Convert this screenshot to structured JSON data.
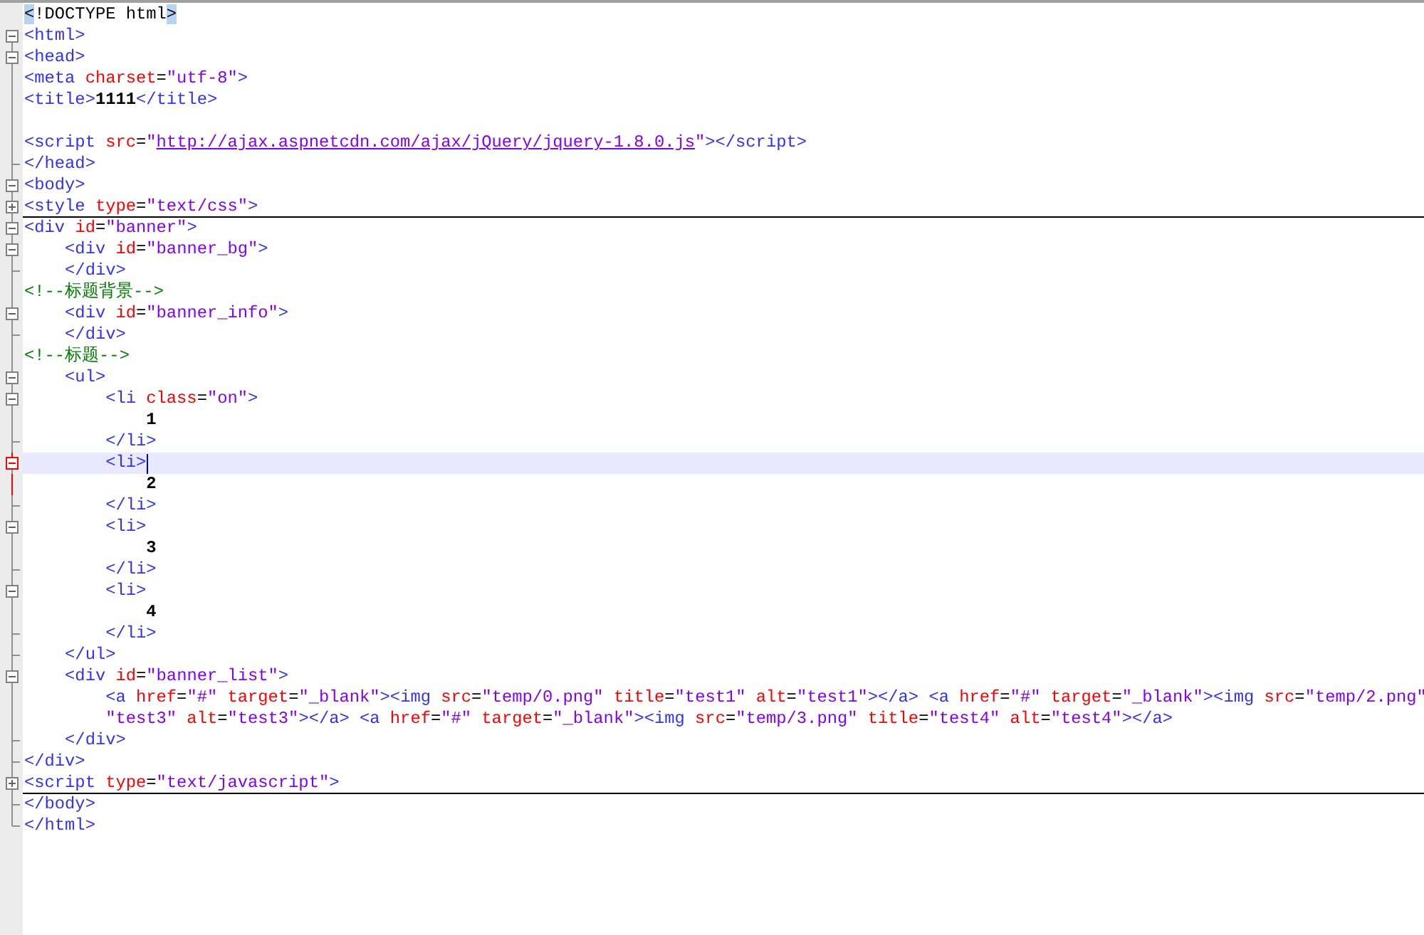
{
  "lines": [
    {
      "kind": "none",
      "tokens": [
        {
          "kind": "brace",
          "text": "<"
        },
        {
          "kind": "plain",
          "text": "!DOCTYPE html"
        },
        {
          "kind": "brace",
          "text": ">"
        }
      ]
    },
    {
      "kind": "root",
      "tokens": [
        {
          "kind": "tag",
          "text": "<html>"
        }
      ]
    },
    {
      "kind": "open",
      "tokens": [
        {
          "kind": "tag",
          "text": "<head>"
        }
      ]
    },
    {
      "kind": "line",
      "tokens": [
        {
          "kind": "tag",
          "text": "<meta "
        },
        {
          "kind": "attr",
          "text": "charset"
        },
        {
          "kind": "plain",
          "text": "="
        },
        {
          "kind": "value",
          "text": "\"utf-8\""
        },
        {
          "kind": "tag",
          "text": ">"
        }
      ]
    },
    {
      "kind": "line",
      "tokens": [
        {
          "kind": "tag",
          "text": "<title>"
        },
        {
          "kind": "text",
          "text": "1111"
        },
        {
          "kind": "tag",
          "text": "</title>"
        }
      ]
    },
    {
      "kind": "line"
    },
    {
      "kind": "line",
      "tokens": [
        {
          "kind": "tag",
          "text": "<script "
        },
        {
          "kind": "attr",
          "text": "src"
        },
        {
          "kind": "plain",
          "text": "="
        },
        {
          "kind": "value",
          "text": "\""
        },
        {
          "kind": "url",
          "text": "http://ajax.aspnetcdn.com/ajax/jQuery/jquery-1.8.0.js"
        },
        {
          "kind": "value",
          "text": "\""
        },
        {
          "kind": "tag",
          "text": "></script>"
        }
      ]
    },
    {
      "kind": "end",
      "tokens": [
        {
          "kind": "tag",
          "text": "</head>"
        }
      ]
    },
    {
      "kind": "open",
      "tokens": [
        {
          "kind": "tag",
          "text": "<body>"
        }
      ]
    },
    {
      "kind": "closed",
      "folded": true,
      "tokens": [
        {
          "kind": "tag",
          "text": "<style "
        },
        {
          "kind": "attr",
          "text": "type"
        },
        {
          "kind": "plain",
          "text": "="
        },
        {
          "kind": "value",
          "text": "\"text/css\""
        },
        {
          "kind": "tag",
          "text": ">"
        }
      ]
    },
    {
      "kind": "open",
      "tokens": [
        {
          "kind": "tag",
          "text": "<div "
        },
        {
          "kind": "attr",
          "text": "id"
        },
        {
          "kind": "plain",
          "text": "="
        },
        {
          "kind": "value",
          "text": "\"banner\""
        },
        {
          "kind": "tag",
          "text": ">"
        }
      ]
    },
    {
      "kind": "open",
      "tokens": [
        {
          "kind": "tag",
          "text": "    <div "
        },
        {
          "kind": "attr",
          "text": "id"
        },
        {
          "kind": "plain",
          "text": "="
        },
        {
          "kind": "value",
          "text": "\"banner_bg\""
        },
        {
          "kind": "tag",
          "text": ">"
        }
      ]
    },
    {
      "kind": "end",
      "tokens": [
        {
          "kind": "tag",
          "text": "    </div>"
        }
      ]
    },
    {
      "kind": "line",
      "tokens": [
        {
          "kind": "comment",
          "text": "<!--标题背景-->"
        }
      ]
    },
    {
      "kind": "open",
      "tokens": [
        {
          "kind": "tag",
          "text": "    <div "
        },
        {
          "kind": "attr",
          "text": "id"
        },
        {
          "kind": "plain",
          "text": "="
        },
        {
          "kind": "value",
          "text": "\"banner_info\""
        },
        {
          "kind": "tag",
          "text": ">"
        }
      ]
    },
    {
      "kind": "end",
      "tokens": [
        {
          "kind": "tag",
          "text": "    </div>"
        }
      ]
    },
    {
      "kind": "line",
      "tokens": [
        {
          "kind": "comment",
          "text": "<!--标题-->"
        }
      ]
    },
    {
      "kind": "open",
      "tokens": [
        {
          "kind": "tag",
          "text": "    <ul>"
        }
      ]
    },
    {
      "kind": "open",
      "tokens": [
        {
          "kind": "tag",
          "text": "        <li "
        },
        {
          "kind": "attr",
          "text": "class"
        },
        {
          "kind": "plain",
          "text": "="
        },
        {
          "kind": "value",
          "text": "\"on\""
        },
        {
          "kind": "tag",
          "text": ">"
        }
      ]
    },
    {
      "kind": "line",
      "tokens": [
        {
          "kind": "text",
          "text": "            1"
        }
      ]
    },
    {
      "kind": "end",
      "tokens": [
        {
          "kind": "tag",
          "text": "        </li>"
        }
      ]
    },
    {
      "kind": "open",
      "current": true,
      "fold_active": true,
      "caret": true,
      "tokens": [
        {
          "kind": "tag",
          "text": "        <li>"
        }
      ]
    },
    {
      "kind": "line",
      "fold_active": true,
      "tokens": [
        {
          "kind": "text",
          "text": "            2"
        }
      ]
    },
    {
      "kind": "end",
      "tokens": [
        {
          "kind": "tag",
          "text": "        </li>"
        }
      ]
    },
    {
      "kind": "open",
      "tokens": [
        {
          "kind": "tag",
          "text": "        <li>"
        }
      ]
    },
    {
      "kind": "line",
      "tokens": [
        {
          "kind": "text",
          "text": "            3"
        }
      ]
    },
    {
      "kind": "end",
      "tokens": [
        {
          "kind": "tag",
          "text": "        </li>"
        }
      ]
    },
    {
      "kind": "open",
      "tokens": [
        {
          "kind": "tag",
          "text": "        <li>"
        }
      ]
    },
    {
      "kind": "line",
      "tokens": [
        {
          "kind": "text",
          "text": "            4"
        }
      ]
    },
    {
      "kind": "end",
      "tokens": [
        {
          "kind": "tag",
          "text": "        </li>"
        }
      ]
    },
    {
      "kind": "end",
      "tokens": [
        {
          "kind": "tag",
          "text": "    </ul>"
        }
      ]
    },
    {
      "kind": "open",
      "tokens": [
        {
          "kind": "tag",
          "text": "    <div "
        },
        {
          "kind": "attr",
          "text": "id"
        },
        {
          "kind": "plain",
          "text": "="
        },
        {
          "kind": "value",
          "text": "\"banner_list\""
        },
        {
          "kind": "tag",
          "text": ">"
        }
      ]
    },
    {
      "kind": "line",
      "tokens": [
        {
          "kind": "tag",
          "text": "        <a "
        },
        {
          "kind": "attr",
          "text": "href"
        },
        {
          "kind": "plain",
          "text": "="
        },
        {
          "kind": "value",
          "text": "\"#\""
        },
        {
          "kind": "attr",
          "text": " target"
        },
        {
          "kind": "plain",
          "text": "="
        },
        {
          "kind": "value",
          "text": "\"_blank\""
        },
        {
          "kind": "tag",
          "text": "><img "
        },
        {
          "kind": "attr",
          "text": "src"
        },
        {
          "kind": "plain",
          "text": "="
        },
        {
          "kind": "value",
          "text": "\"temp/0.png\""
        },
        {
          "kind": "attr",
          "text": " title"
        },
        {
          "kind": "plain",
          "text": "="
        },
        {
          "kind": "value",
          "text": "\"test1\""
        },
        {
          "kind": "attr",
          "text": " alt"
        },
        {
          "kind": "plain",
          "text": "="
        },
        {
          "kind": "value",
          "text": "\"test1\""
        },
        {
          "kind": "tag",
          "text": "></a> <a "
        },
        {
          "kind": "attr",
          "text": "href"
        },
        {
          "kind": "plain",
          "text": "="
        },
        {
          "kind": "value",
          "text": "\"#\""
        },
        {
          "kind": "attr",
          "text": " target"
        },
        {
          "kind": "plain",
          "text": "="
        },
        {
          "kind": "value",
          "text": "\"_blank\""
        },
        {
          "kind": "tag",
          "text": "><img "
        },
        {
          "kind": "attr",
          "text": "src"
        },
        {
          "kind": "plain",
          "text": "="
        },
        {
          "kind": "value",
          "text": "\"temp/2.png\""
        }
      ]
    },
    {
      "kind": "line",
      "tokens": [
        {
          "kind": "value",
          "text": "        \"test3\""
        },
        {
          "kind": "attr",
          "text": " alt"
        },
        {
          "kind": "plain",
          "text": "="
        },
        {
          "kind": "value",
          "text": "\"test3\""
        },
        {
          "kind": "tag",
          "text": "></a> <a "
        },
        {
          "kind": "attr",
          "text": "href"
        },
        {
          "kind": "plain",
          "text": "="
        },
        {
          "kind": "value",
          "text": "\"#\""
        },
        {
          "kind": "attr",
          "text": " target"
        },
        {
          "kind": "plain",
          "text": "="
        },
        {
          "kind": "value",
          "text": "\"_blank\""
        },
        {
          "kind": "tag",
          "text": "><img "
        },
        {
          "kind": "attr",
          "text": "src"
        },
        {
          "kind": "plain",
          "text": "="
        },
        {
          "kind": "value",
          "text": "\"temp/3.png\""
        },
        {
          "kind": "attr",
          "text": " title"
        },
        {
          "kind": "plain",
          "text": "="
        },
        {
          "kind": "value",
          "text": "\"test4\""
        },
        {
          "kind": "attr",
          "text": " alt"
        },
        {
          "kind": "plain",
          "text": "="
        },
        {
          "kind": "value",
          "text": "\"test4\""
        },
        {
          "kind": "tag",
          "text": "></a>"
        }
      ]
    },
    {
      "kind": "end",
      "tokens": [
        {
          "kind": "tag",
          "text": "    </div>"
        }
      ]
    },
    {
      "kind": "end",
      "tokens": [
        {
          "kind": "tag",
          "text": "</div>"
        }
      ]
    },
    {
      "kind": "closed",
      "folded": true,
      "tokens": [
        {
          "kind": "tag",
          "text": "<script "
        },
        {
          "kind": "attr",
          "text": "type"
        },
        {
          "kind": "plain",
          "text": "="
        },
        {
          "kind": "value",
          "text": "\"text/javascript\""
        },
        {
          "kind": "tag",
          "text": ">"
        }
      ]
    },
    {
      "kind": "end",
      "tokens": [
        {
          "kind": "tag",
          "text": "</body>"
        }
      ]
    },
    {
      "kind": "last",
      "tokens": [
        {
          "kind": "tag",
          "text": "</html>"
        }
      ]
    }
  ]
}
